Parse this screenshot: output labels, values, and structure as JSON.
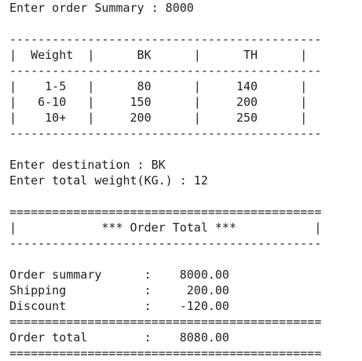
{
  "console": {
    "lines": [
      "Enter order Summary : 8000",
      "",
      "--------------------------------------------",
      "|  Weight  |      BK      |      TH      |",
      "--------------------------------------------",
      "|    1-5   |      80      |     140      |",
      "|   6-10   |     150      |     200      |",
      "|    10+   |     200      |     250      |",
      "--------------------------------------------",
      "",
      "Enter destination : BK",
      "Enter total weight(KG.) : 12",
      "",
      "============================================",
      "|            *** Order Total ***           |",
      "--------------------------------------------",
      "",
      "Order summary      :    8000.00",
      "Shipping           :     200.00",
      "Discount           :    -120.00",
      "============================================",
      "Order total        :    8080.00",
      "============================================"
    ]
  }
}
